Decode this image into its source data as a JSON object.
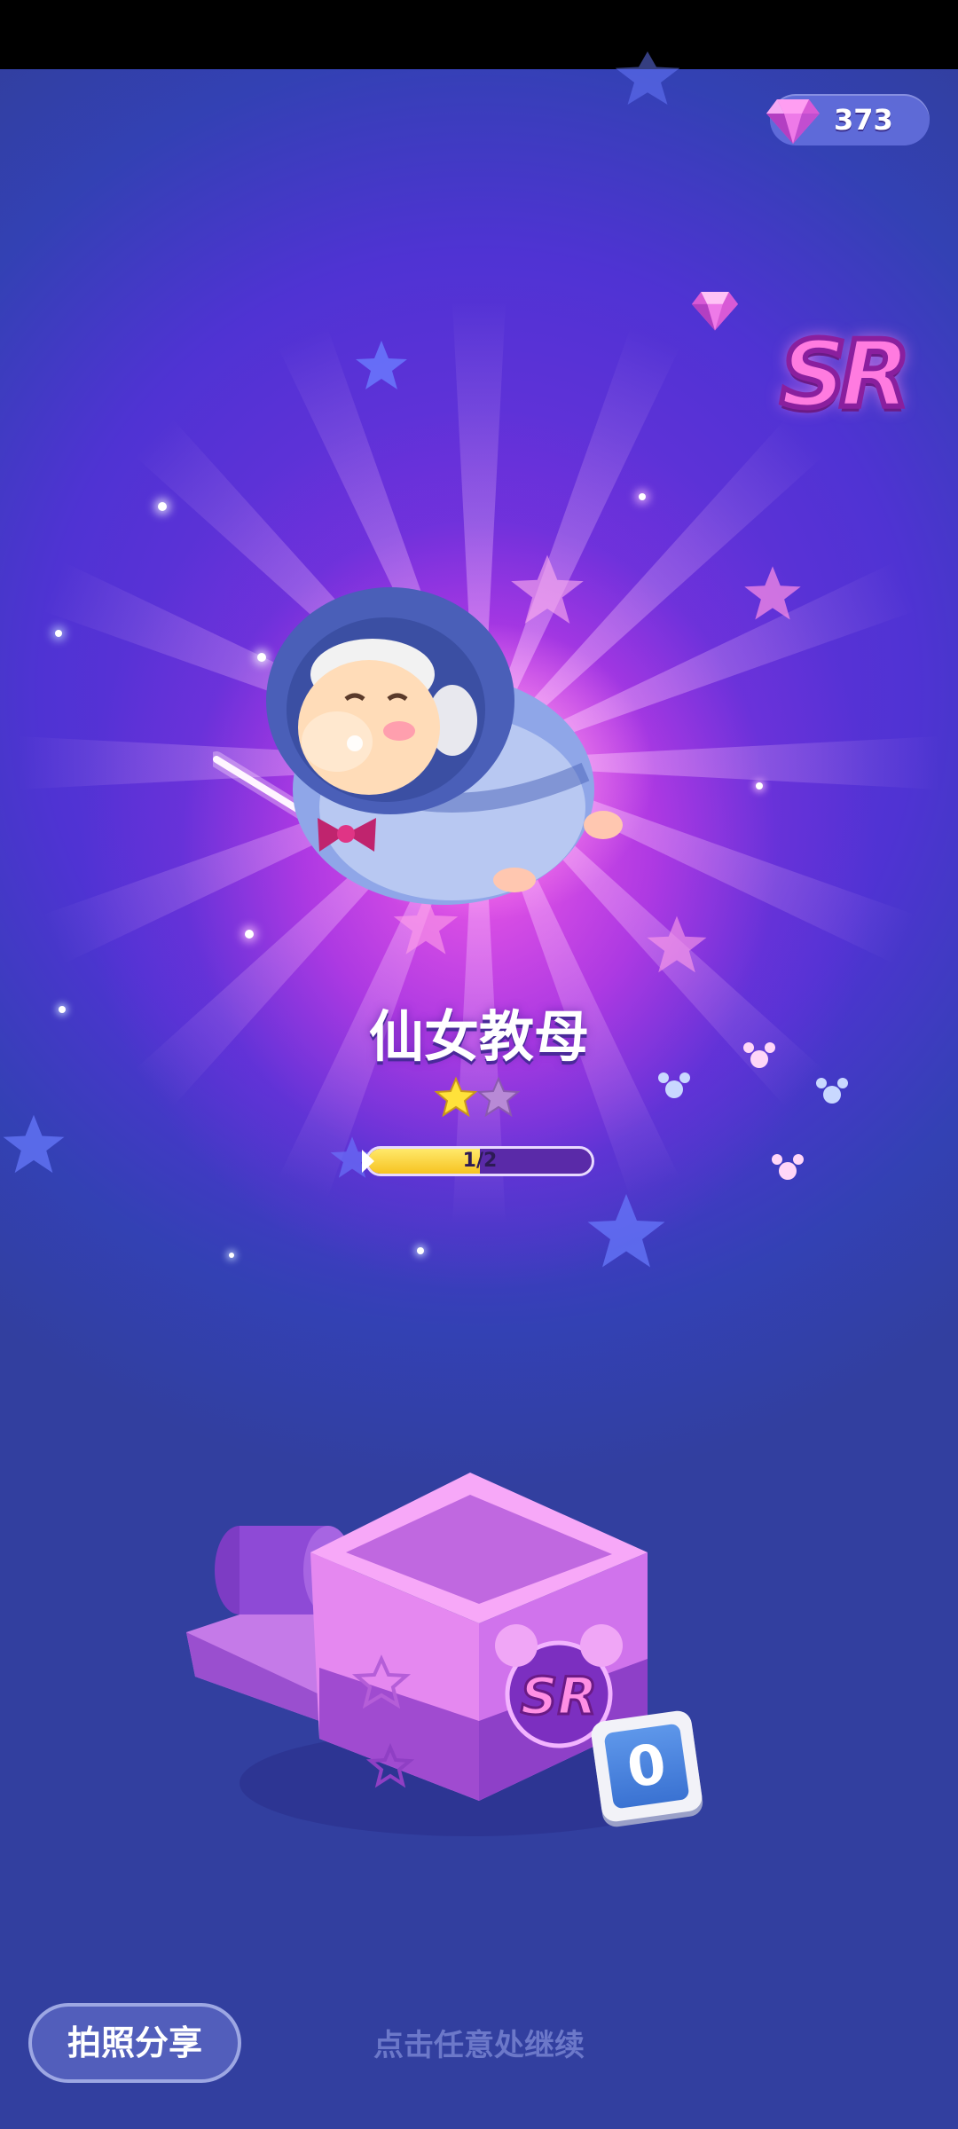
{
  "currency": {
    "gem_count": "373",
    "gem_icon": "gem-icon"
  },
  "rarity": {
    "label": "SR"
  },
  "character": {
    "name": "仙女教母",
    "stars_filled": 1,
    "stars_total": 2,
    "progress_text": "1/2",
    "progress_fraction": 0.5
  },
  "box": {
    "rarity_label": "SR",
    "count": "0"
  },
  "actions": {
    "share_label": "拍照分享",
    "continue_hint": "点击任意处继续"
  },
  "colors": {
    "accent_pink": "#ff7be0",
    "progress_fill": "#f6c322",
    "badge_blue": "#3a72d2"
  }
}
